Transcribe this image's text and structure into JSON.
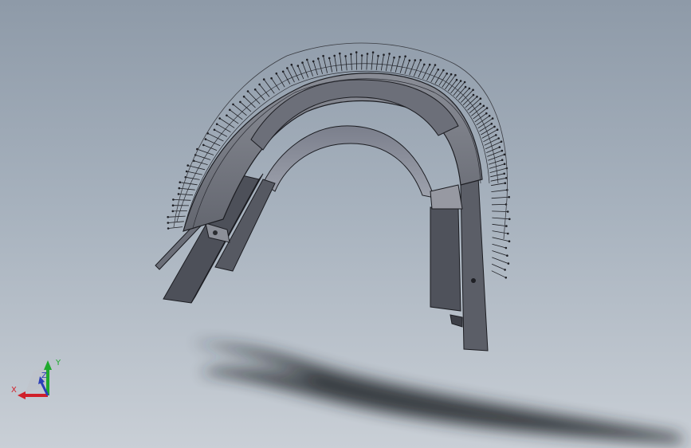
{
  "viewport": {
    "background_top": "#8e9aa8",
    "background_bottom": "#c9cfd6",
    "model": {
      "body_color": "#5c5f68",
      "edge_color": "#1c1d22",
      "shadow_color": "#2a2c30"
    }
  },
  "triad": {
    "x_label": "X",
    "y_label": "Y",
    "z_label": "Z",
    "x_color": "#d0202a",
    "y_color": "#1faa2e",
    "z_color": "#2b3fb8"
  }
}
